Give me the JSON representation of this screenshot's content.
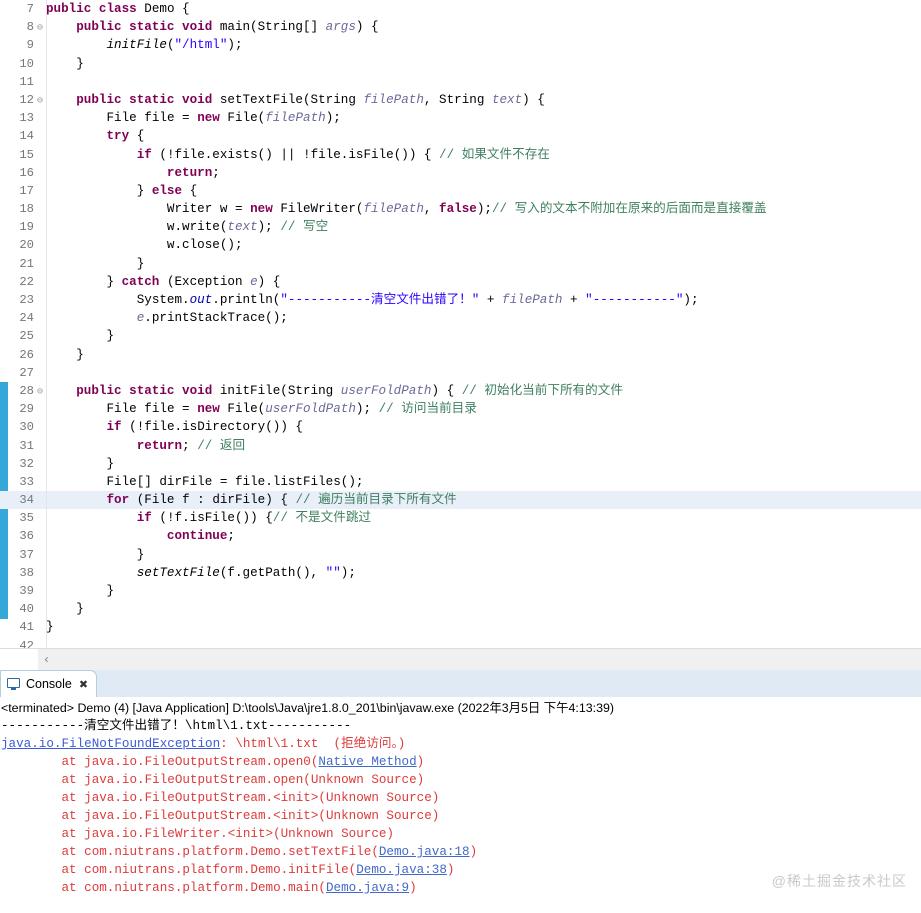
{
  "editor": {
    "current_line": 34,
    "marker_bar": {
      "color": "#35a7d8",
      "from_line": 28,
      "to_line": 40
    },
    "lines": [
      {
        "num": "7",
        "fold": "",
        "segments": [
          {
            "t": "",
            "c": "pln"
          },
          {
            "t": "public ",
            "c": "kw"
          },
          {
            "t": "class ",
            "c": "kw"
          },
          {
            "t": "Demo {",
            "c": "pln"
          }
        ]
      },
      {
        "num": "8",
        "fold": "⊖",
        "segments": [
          {
            "t": "    ",
            "c": "pln"
          },
          {
            "t": "public static void ",
            "c": "kw"
          },
          {
            "t": "main(",
            "c": "pln"
          },
          {
            "t": "String",
            "c": "pln"
          },
          {
            "t": "[] ",
            "c": "pln"
          },
          {
            "t": "args",
            "c": "prm"
          },
          {
            "t": ") {",
            "c": "pln"
          }
        ]
      },
      {
        "num": "9",
        "fold": "",
        "segments": [
          {
            "t": "        ",
            "c": "pln"
          },
          {
            "t": "initFile",
            "c": "smth"
          },
          {
            "t": "(",
            "c": "pln"
          },
          {
            "t": "\"/html\"",
            "c": "str"
          },
          {
            "t": ");",
            "c": "pln"
          }
        ]
      },
      {
        "num": "10",
        "fold": "",
        "segments": [
          {
            "t": "    }",
            "c": "pln"
          }
        ]
      },
      {
        "num": "11",
        "fold": "",
        "segments": [
          {
            "t": "",
            "c": "pln"
          }
        ]
      },
      {
        "num": "12",
        "fold": "⊖",
        "segments": [
          {
            "t": "    ",
            "c": "pln"
          },
          {
            "t": "public static void ",
            "c": "kw"
          },
          {
            "t": "setTextFile(",
            "c": "pln"
          },
          {
            "t": "String ",
            "c": "pln"
          },
          {
            "t": "filePath",
            "c": "prm"
          },
          {
            "t": ", ",
            "c": "pln"
          },
          {
            "t": "String ",
            "c": "pln"
          },
          {
            "t": "text",
            "c": "prm"
          },
          {
            "t": ") {",
            "c": "pln"
          }
        ]
      },
      {
        "num": "13",
        "fold": "",
        "segments": [
          {
            "t": "        ",
            "c": "pln"
          },
          {
            "t": "File ",
            "c": "pln"
          },
          {
            "t": "file",
            "c": "lvar"
          },
          {
            "t": " = ",
            "c": "pln"
          },
          {
            "t": "new ",
            "c": "kw"
          },
          {
            "t": "File(",
            "c": "pln"
          },
          {
            "t": "filePath",
            "c": "prm"
          },
          {
            "t": ");",
            "c": "pln"
          }
        ]
      },
      {
        "num": "14",
        "fold": "",
        "segments": [
          {
            "t": "        ",
            "c": "pln"
          },
          {
            "t": "try ",
            "c": "kw"
          },
          {
            "t": "{",
            "c": "pln"
          }
        ]
      },
      {
        "num": "15",
        "fold": "",
        "segments": [
          {
            "t": "            ",
            "c": "pln"
          },
          {
            "t": "if ",
            "c": "kw"
          },
          {
            "t": "(!",
            "c": "pln"
          },
          {
            "t": "file",
            "c": "lvar"
          },
          {
            "t": ".exists() || !",
            "c": "pln"
          },
          {
            "t": "file",
            "c": "lvar"
          },
          {
            "t": ".isFile()) { ",
            "c": "pln"
          },
          {
            "t": "// 如果文件不存在",
            "c": "cmt"
          }
        ]
      },
      {
        "num": "16",
        "fold": "",
        "segments": [
          {
            "t": "                ",
            "c": "pln"
          },
          {
            "t": "return",
            "c": "kw"
          },
          {
            "t": ";",
            "c": "pln"
          }
        ]
      },
      {
        "num": "17",
        "fold": "",
        "segments": [
          {
            "t": "            } ",
            "c": "pln"
          },
          {
            "t": "else ",
            "c": "kw"
          },
          {
            "t": "{",
            "c": "pln"
          }
        ]
      },
      {
        "num": "18",
        "fold": "",
        "segments": [
          {
            "t": "                ",
            "c": "pln"
          },
          {
            "t": "Writer ",
            "c": "pln"
          },
          {
            "t": "w",
            "c": "lvar"
          },
          {
            "t": " = ",
            "c": "pln"
          },
          {
            "t": "new ",
            "c": "kw"
          },
          {
            "t": "FileWriter(",
            "c": "pln"
          },
          {
            "t": "filePath",
            "c": "prm"
          },
          {
            "t": ", ",
            "c": "pln"
          },
          {
            "t": "false",
            "c": "kw"
          },
          {
            "t": ");",
            "c": "pln"
          },
          {
            "t": "// 写入的文本不附加在原来的后面而是直接覆盖",
            "c": "cmt"
          }
        ]
      },
      {
        "num": "19",
        "fold": "",
        "segments": [
          {
            "t": "                ",
            "c": "pln"
          },
          {
            "t": "w",
            "c": "lvar"
          },
          {
            "t": ".write(",
            "c": "pln"
          },
          {
            "t": "text",
            "c": "prm"
          },
          {
            "t": "); ",
            "c": "pln"
          },
          {
            "t": "// 写空",
            "c": "cmt"
          }
        ]
      },
      {
        "num": "20",
        "fold": "",
        "segments": [
          {
            "t": "                ",
            "c": "pln"
          },
          {
            "t": "w",
            "c": "lvar"
          },
          {
            "t": ".close();",
            "c": "pln"
          }
        ]
      },
      {
        "num": "21",
        "fold": "",
        "segments": [
          {
            "t": "            }",
            "c": "pln"
          }
        ]
      },
      {
        "num": "22",
        "fold": "",
        "segments": [
          {
            "t": "        } ",
            "c": "pln"
          },
          {
            "t": "catch ",
            "c": "kw"
          },
          {
            "t": "(Exception ",
            "c": "pln"
          },
          {
            "t": "e",
            "c": "prm"
          },
          {
            "t": ") {",
            "c": "pln"
          }
        ]
      },
      {
        "num": "23",
        "fold": "",
        "segments": [
          {
            "t": "            ",
            "c": "pln"
          },
          {
            "t": "System.",
            "c": "pln"
          },
          {
            "t": "out",
            "c": "sfld"
          },
          {
            "t": ".println(",
            "c": "pln"
          },
          {
            "t": "\"-----------清空文件出错了！\"",
            "c": "str"
          },
          {
            "t": " + ",
            "c": "pln"
          },
          {
            "t": "filePath",
            "c": "prm"
          },
          {
            "t": " + ",
            "c": "pln"
          },
          {
            "t": "\"-----------\"",
            "c": "str"
          },
          {
            "t": ");",
            "c": "pln"
          }
        ]
      },
      {
        "num": "24",
        "fold": "",
        "segments": [
          {
            "t": "            ",
            "c": "pln"
          },
          {
            "t": "e",
            "c": "prm"
          },
          {
            "t": ".printStackTrace();",
            "c": "pln"
          }
        ]
      },
      {
        "num": "25",
        "fold": "",
        "segments": [
          {
            "t": "        }",
            "c": "pln"
          }
        ]
      },
      {
        "num": "26",
        "fold": "",
        "segments": [
          {
            "t": "    }",
            "c": "pln"
          }
        ]
      },
      {
        "num": "27",
        "fold": "",
        "segments": [
          {
            "t": "",
            "c": "pln"
          }
        ]
      },
      {
        "num": "28",
        "fold": "⊖",
        "segments": [
          {
            "t": "    ",
            "c": "pln"
          },
          {
            "t": "public static void ",
            "c": "kw"
          },
          {
            "t": "initFile(",
            "c": "pln"
          },
          {
            "t": "String ",
            "c": "pln"
          },
          {
            "t": "userFoldPath",
            "c": "prm"
          },
          {
            "t": ") { ",
            "c": "pln"
          },
          {
            "t": "// 初始化当前下所有的文件",
            "c": "cmt"
          }
        ]
      },
      {
        "num": "29",
        "fold": "",
        "segments": [
          {
            "t": "        ",
            "c": "pln"
          },
          {
            "t": "File ",
            "c": "pln"
          },
          {
            "t": "file",
            "c": "lvar"
          },
          {
            "t": " = ",
            "c": "pln"
          },
          {
            "t": "new ",
            "c": "kw"
          },
          {
            "t": "File(",
            "c": "pln"
          },
          {
            "t": "userFoldPath",
            "c": "prm"
          },
          {
            "t": "); ",
            "c": "pln"
          },
          {
            "t": "// 访问当前目录",
            "c": "cmt"
          }
        ]
      },
      {
        "num": "30",
        "fold": "",
        "segments": [
          {
            "t": "        ",
            "c": "pln"
          },
          {
            "t": "if ",
            "c": "kw"
          },
          {
            "t": "(!",
            "c": "pln"
          },
          {
            "t": "file",
            "c": "lvar"
          },
          {
            "t": ".isDirectory()) {",
            "c": "pln"
          }
        ]
      },
      {
        "num": "31",
        "fold": "",
        "segments": [
          {
            "t": "            ",
            "c": "pln"
          },
          {
            "t": "return",
            "c": "kw"
          },
          {
            "t": "; ",
            "c": "pln"
          },
          {
            "t": "// 返回",
            "c": "cmt"
          }
        ]
      },
      {
        "num": "32",
        "fold": "",
        "segments": [
          {
            "t": "        }",
            "c": "pln"
          }
        ]
      },
      {
        "num": "33",
        "fold": "",
        "segments": [
          {
            "t": "        ",
            "c": "pln"
          },
          {
            "t": "File[] ",
            "c": "pln"
          },
          {
            "t": "dirFile",
            "c": "lvar"
          },
          {
            "t": " = ",
            "c": "pln"
          },
          {
            "t": "file",
            "c": "lvar"
          },
          {
            "t": ".listFiles();",
            "c": "pln"
          }
        ]
      },
      {
        "num": "34",
        "fold": "",
        "segments": [
          {
            "t": "        ",
            "c": "pln"
          },
          {
            "t": "for ",
            "c": "kw"
          },
          {
            "t": "(File ",
            "c": "pln"
          },
          {
            "t": "f",
            "c": "lvar"
          },
          {
            "t": " : ",
            "c": "pln"
          },
          {
            "t": "dirFile",
            "c": "lvar"
          },
          {
            "t": ") { ",
            "c": "pln"
          },
          {
            "t": "// 遍历当前目录下所有文件",
            "c": "cmt"
          }
        ]
      },
      {
        "num": "35",
        "fold": "",
        "segments": [
          {
            "t": "            ",
            "c": "pln"
          },
          {
            "t": "if ",
            "c": "kw"
          },
          {
            "t": "(!",
            "c": "pln"
          },
          {
            "t": "f",
            "c": "lvar"
          },
          {
            "t": ".isFile()) {",
            "c": "pln"
          },
          {
            "t": "// 不是文件跳过",
            "c": "cmt"
          }
        ]
      },
      {
        "num": "36",
        "fold": "",
        "segments": [
          {
            "t": "                ",
            "c": "pln"
          },
          {
            "t": "continue",
            "c": "kw"
          },
          {
            "t": ";",
            "c": "pln"
          }
        ]
      },
      {
        "num": "37",
        "fold": "",
        "segments": [
          {
            "t": "            }",
            "c": "pln"
          }
        ]
      },
      {
        "num": "38",
        "fold": "",
        "segments": [
          {
            "t": "            ",
            "c": "pln"
          },
          {
            "t": "setTextFile",
            "c": "smth"
          },
          {
            "t": "(",
            "c": "pln"
          },
          {
            "t": "f",
            "c": "lvar"
          },
          {
            "t": ".getPath(), ",
            "c": "pln"
          },
          {
            "t": "\"\"",
            "c": "str"
          },
          {
            "t": ");",
            "c": "pln"
          }
        ]
      },
      {
        "num": "39",
        "fold": "",
        "segments": [
          {
            "t": "        }",
            "c": "pln"
          }
        ]
      },
      {
        "num": "40",
        "fold": "",
        "segments": [
          {
            "t": "    }",
            "c": "pln"
          }
        ]
      },
      {
        "num": "41",
        "fold": "",
        "segments": [
          {
            "t": "}",
            "c": "pln"
          }
        ]
      },
      {
        "num": "42",
        "fold": "",
        "segments": [
          {
            "t": "",
            "c": "pln"
          }
        ]
      }
    ],
    "hscroll": {
      "left_arrow": "‹"
    }
  },
  "console": {
    "tab": {
      "label": "Console",
      "close": "✖",
      "icon": "console-monitor-icon"
    },
    "launch_header": "<terminated> Demo (4) [Java Application] D:\\tools\\Java\\jre1.8.0_201\\bin\\javaw.exe (2022年3月5日 下午4:13:39)",
    "output": [
      {
        "parts": [
          {
            "text": "-----------清空文件出错了！\\html\\1.txt-----------",
            "style": "c-black"
          }
        ]
      },
      {
        "parts": [
          {
            "text": "java.io.FileNotFoundException",
            "style": "c-blue"
          },
          {
            "text": ": \\html\\1.txt  (拒绝访问。)",
            "style": "c-red"
          }
        ]
      },
      {
        "parts": [
          {
            "text": "        at java.io.FileOutputStream.open0(",
            "style": "c-red"
          },
          {
            "text": "Native Method",
            "style": "c-link"
          },
          {
            "text": ")",
            "style": "c-red"
          }
        ]
      },
      {
        "parts": [
          {
            "text": "        at java.io.FileOutputStream.open(Unknown Source)",
            "style": "c-red"
          }
        ]
      },
      {
        "parts": [
          {
            "text": "        at java.io.FileOutputStream.<init>(Unknown Source)",
            "style": "c-red"
          }
        ]
      },
      {
        "parts": [
          {
            "text": "        at java.io.FileOutputStream.<init>(Unknown Source)",
            "style": "c-red"
          }
        ]
      },
      {
        "parts": [
          {
            "text": "        at java.io.FileWriter.<init>(Unknown Source)",
            "style": "c-red"
          }
        ]
      },
      {
        "parts": [
          {
            "text": "        at com.niutrans.platform.Demo.setTextFile(",
            "style": "c-red"
          },
          {
            "text": "Demo.java:18",
            "style": "c-link"
          },
          {
            "text": ")",
            "style": "c-red"
          }
        ]
      },
      {
        "parts": [
          {
            "text": "        at com.niutrans.platform.Demo.initFile(",
            "style": "c-red"
          },
          {
            "text": "Demo.java:38",
            "style": "c-link"
          },
          {
            "text": ")",
            "style": "c-red"
          }
        ]
      },
      {
        "parts": [
          {
            "text": "        at com.niutrans.platform.Demo.main(",
            "style": "c-red"
          },
          {
            "text": "Demo.java:9",
            "style": "c-link"
          },
          {
            "text": ")",
            "style": "c-red"
          }
        ]
      }
    ]
  },
  "watermark": {
    "text": "@稀土掘金技术社区"
  }
}
